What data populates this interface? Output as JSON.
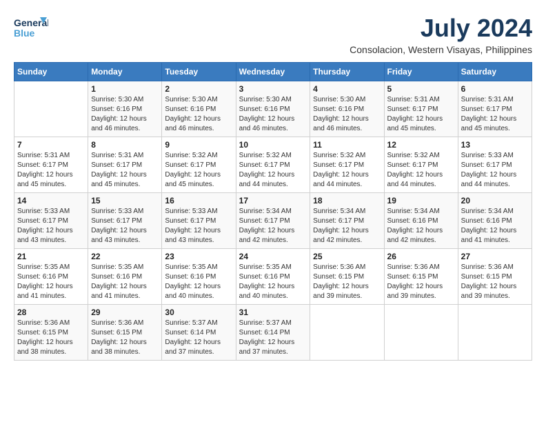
{
  "logo": {
    "line1": "General",
    "line2": "Blue"
  },
  "title": {
    "month_year": "July 2024",
    "location": "Consolacion, Western Visayas, Philippines"
  },
  "headers": [
    "Sunday",
    "Monday",
    "Tuesday",
    "Wednesday",
    "Thursday",
    "Friday",
    "Saturday"
  ],
  "weeks": [
    [
      {
        "day": "",
        "info": ""
      },
      {
        "day": "1",
        "info": "Sunrise: 5:30 AM\nSunset: 6:16 PM\nDaylight: 12 hours\nand 46 minutes."
      },
      {
        "day": "2",
        "info": "Sunrise: 5:30 AM\nSunset: 6:16 PM\nDaylight: 12 hours\nand 46 minutes."
      },
      {
        "day": "3",
        "info": "Sunrise: 5:30 AM\nSunset: 6:16 PM\nDaylight: 12 hours\nand 46 minutes."
      },
      {
        "day": "4",
        "info": "Sunrise: 5:30 AM\nSunset: 6:16 PM\nDaylight: 12 hours\nand 46 minutes."
      },
      {
        "day": "5",
        "info": "Sunrise: 5:31 AM\nSunset: 6:17 PM\nDaylight: 12 hours\nand 45 minutes."
      },
      {
        "day": "6",
        "info": "Sunrise: 5:31 AM\nSunset: 6:17 PM\nDaylight: 12 hours\nand 45 minutes."
      }
    ],
    [
      {
        "day": "7",
        "info": "Sunrise: 5:31 AM\nSunset: 6:17 PM\nDaylight: 12 hours\nand 45 minutes."
      },
      {
        "day": "8",
        "info": "Sunrise: 5:31 AM\nSunset: 6:17 PM\nDaylight: 12 hours\nand 45 minutes."
      },
      {
        "day": "9",
        "info": "Sunrise: 5:32 AM\nSunset: 6:17 PM\nDaylight: 12 hours\nand 45 minutes."
      },
      {
        "day": "10",
        "info": "Sunrise: 5:32 AM\nSunset: 6:17 PM\nDaylight: 12 hours\nand 44 minutes."
      },
      {
        "day": "11",
        "info": "Sunrise: 5:32 AM\nSunset: 6:17 PM\nDaylight: 12 hours\nand 44 minutes."
      },
      {
        "day": "12",
        "info": "Sunrise: 5:32 AM\nSunset: 6:17 PM\nDaylight: 12 hours\nand 44 minutes."
      },
      {
        "day": "13",
        "info": "Sunrise: 5:33 AM\nSunset: 6:17 PM\nDaylight: 12 hours\nand 44 minutes."
      }
    ],
    [
      {
        "day": "14",
        "info": "Sunrise: 5:33 AM\nSunset: 6:17 PM\nDaylight: 12 hours\nand 43 minutes."
      },
      {
        "day": "15",
        "info": "Sunrise: 5:33 AM\nSunset: 6:17 PM\nDaylight: 12 hours\nand 43 minutes."
      },
      {
        "day": "16",
        "info": "Sunrise: 5:33 AM\nSunset: 6:17 PM\nDaylight: 12 hours\nand 43 minutes."
      },
      {
        "day": "17",
        "info": "Sunrise: 5:34 AM\nSunset: 6:17 PM\nDaylight: 12 hours\nand 42 minutes."
      },
      {
        "day": "18",
        "info": "Sunrise: 5:34 AM\nSunset: 6:17 PM\nDaylight: 12 hours\nand 42 minutes."
      },
      {
        "day": "19",
        "info": "Sunrise: 5:34 AM\nSunset: 6:16 PM\nDaylight: 12 hours\nand 42 minutes."
      },
      {
        "day": "20",
        "info": "Sunrise: 5:34 AM\nSunset: 6:16 PM\nDaylight: 12 hours\nand 41 minutes."
      }
    ],
    [
      {
        "day": "21",
        "info": "Sunrise: 5:35 AM\nSunset: 6:16 PM\nDaylight: 12 hours\nand 41 minutes."
      },
      {
        "day": "22",
        "info": "Sunrise: 5:35 AM\nSunset: 6:16 PM\nDaylight: 12 hours\nand 41 minutes."
      },
      {
        "day": "23",
        "info": "Sunrise: 5:35 AM\nSunset: 6:16 PM\nDaylight: 12 hours\nand 40 minutes."
      },
      {
        "day": "24",
        "info": "Sunrise: 5:35 AM\nSunset: 6:16 PM\nDaylight: 12 hours\nand 40 minutes."
      },
      {
        "day": "25",
        "info": "Sunrise: 5:36 AM\nSunset: 6:15 PM\nDaylight: 12 hours\nand 39 minutes."
      },
      {
        "day": "26",
        "info": "Sunrise: 5:36 AM\nSunset: 6:15 PM\nDaylight: 12 hours\nand 39 minutes."
      },
      {
        "day": "27",
        "info": "Sunrise: 5:36 AM\nSunset: 6:15 PM\nDaylight: 12 hours\nand 39 minutes."
      }
    ],
    [
      {
        "day": "28",
        "info": "Sunrise: 5:36 AM\nSunset: 6:15 PM\nDaylight: 12 hours\nand 38 minutes."
      },
      {
        "day": "29",
        "info": "Sunrise: 5:36 AM\nSunset: 6:15 PM\nDaylight: 12 hours\nand 38 minutes."
      },
      {
        "day": "30",
        "info": "Sunrise: 5:37 AM\nSunset: 6:14 PM\nDaylight: 12 hours\nand 37 minutes."
      },
      {
        "day": "31",
        "info": "Sunrise: 5:37 AM\nSunset: 6:14 PM\nDaylight: 12 hours\nand 37 minutes."
      },
      {
        "day": "",
        "info": ""
      },
      {
        "day": "",
        "info": ""
      },
      {
        "day": "",
        "info": ""
      }
    ]
  ]
}
